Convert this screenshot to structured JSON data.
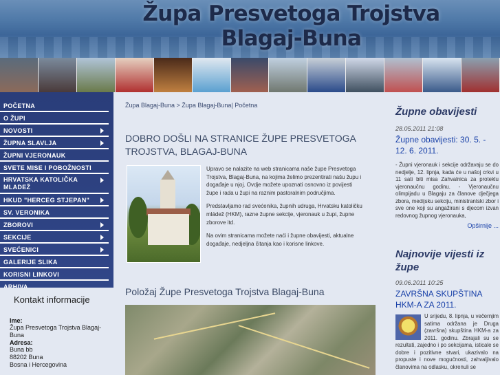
{
  "header": {
    "title_line1": "Župa Presvetoga Trojstva",
    "title_line2": "Blagaj-Buna"
  },
  "colors": {
    "nav_bg": "#2a3d7a",
    "accent_link": "#1840a8",
    "heading": "#3b4a66"
  },
  "nav": {
    "items": [
      {
        "label": "POČETNA",
        "has_submenu": false
      },
      {
        "label": "O ŽUPI",
        "has_submenu": false
      },
      {
        "label": "NOVOSTI",
        "has_submenu": true
      },
      {
        "label": "ŽUPNA SLAVLJA",
        "has_submenu": true
      },
      {
        "label": "ŽUPNI VJERONAUK",
        "has_submenu": false
      },
      {
        "label": "SVETE MISE I POBOŽNOSTI",
        "has_submenu": false
      },
      {
        "label": "HRVATSKA KATOLIČKA MLADEŽ",
        "has_submenu": true
      },
      {
        "label": "HKUD \"HERCEG STJEPAN\"",
        "has_submenu": true
      },
      {
        "label": "SV. VERONIKA",
        "has_submenu": false
      },
      {
        "label": "ZBOROVI",
        "has_submenu": true
      },
      {
        "label": "SEKCIJE",
        "has_submenu": true
      },
      {
        "label": "SVEĆENICI",
        "has_submenu": true
      },
      {
        "label": "GALERIJE SLIKA",
        "has_submenu": false
      },
      {
        "label": "KORISNI LINKOVI",
        "has_submenu": false
      },
      {
        "label": "ARHIVA",
        "has_submenu": false
      }
    ]
  },
  "contact": {
    "heading": "Kontakt informacije",
    "name_label": "Ime:",
    "name_value": "Župa Presvetoga Trojstva Blagaj-Buna",
    "address_label": "Adresa:",
    "address_line1": "Buna bb",
    "address_line2": "88202 Buna",
    "address_line3": "Bosna i Hercegovina"
  },
  "main": {
    "breadcrumb": "Župa Blagaj-Buna > Župa Blagaj-Buna| Početna",
    "welcome_title": "DOBRO DOŠLI NA STRANICE ŽUPE PRESVETOGA TROJSTVA, BLAGAJ-BUNA",
    "paragraphs": [
      "Upravo se nalazite na web stranicama naše župe Presvetoga Trojstva, Blagaj-Buna, na kojima želimo prezentirati našu župu i događaje u njoj. Ovdje možete upoznati osnovno iz povijesti župe i rada u župi na raznim pastoralnim područjima.",
      "Predstavljamo rad svećenika, župnih udruga, Hrvatsku katoličku mládež (HKM), razne župne sekcije, vjeronauk u župi, župne zborove itd.",
      "Na ovim stranicama možete naći i župne obavijesti, aktualne događaje, nedjeljna čitanja kao i korisne linkove."
    ],
    "map_title": "Položaj Župe Presvetoga Trojstva Blagaj-Buna"
  },
  "right": {
    "notices_heading": "Župne obavijesti",
    "notice_date": "28.05.2011 21:08",
    "notice_title": "Župne obavijesti: 30. 5. - 12. 6. 2011.",
    "notice_body": "- Župni vjeronauk i sekcije održavaju se do nedjelje, 12. lipnja, kada će u našoj crkvi u 11 sati biti misa Zahvalnica za proteklu vjeronaučnu godinu. - Vjeronaučnu olimpijadu u Blagaju za članove dječjega zbora, medijsku sekciju, ministrantski zbor i sve one koji su angažirani s djecom izvan redovnog župnog vjeronauka,",
    "more_label": "Opširnije ...",
    "news_heading": "Najnovije vijesti iz župe",
    "news_date": "09.06.2011 10:25",
    "news_title": "ZAVRŠNA SKUPŠTINA HKM-A ZA 2011.",
    "news_body": "U srijedu, 8. lipnja, u večernjim satima održana je Druga (završna) skupština HKM-a za 2011. godinu. Zbrajali su se rezultati, zajedno i po sekcijama, isticale se dobre i pozitivne stvari, ukazivalo na propuste i nove mogućnosti, zahvaljivalo članovima na odlasku, okrenuli se"
  }
}
